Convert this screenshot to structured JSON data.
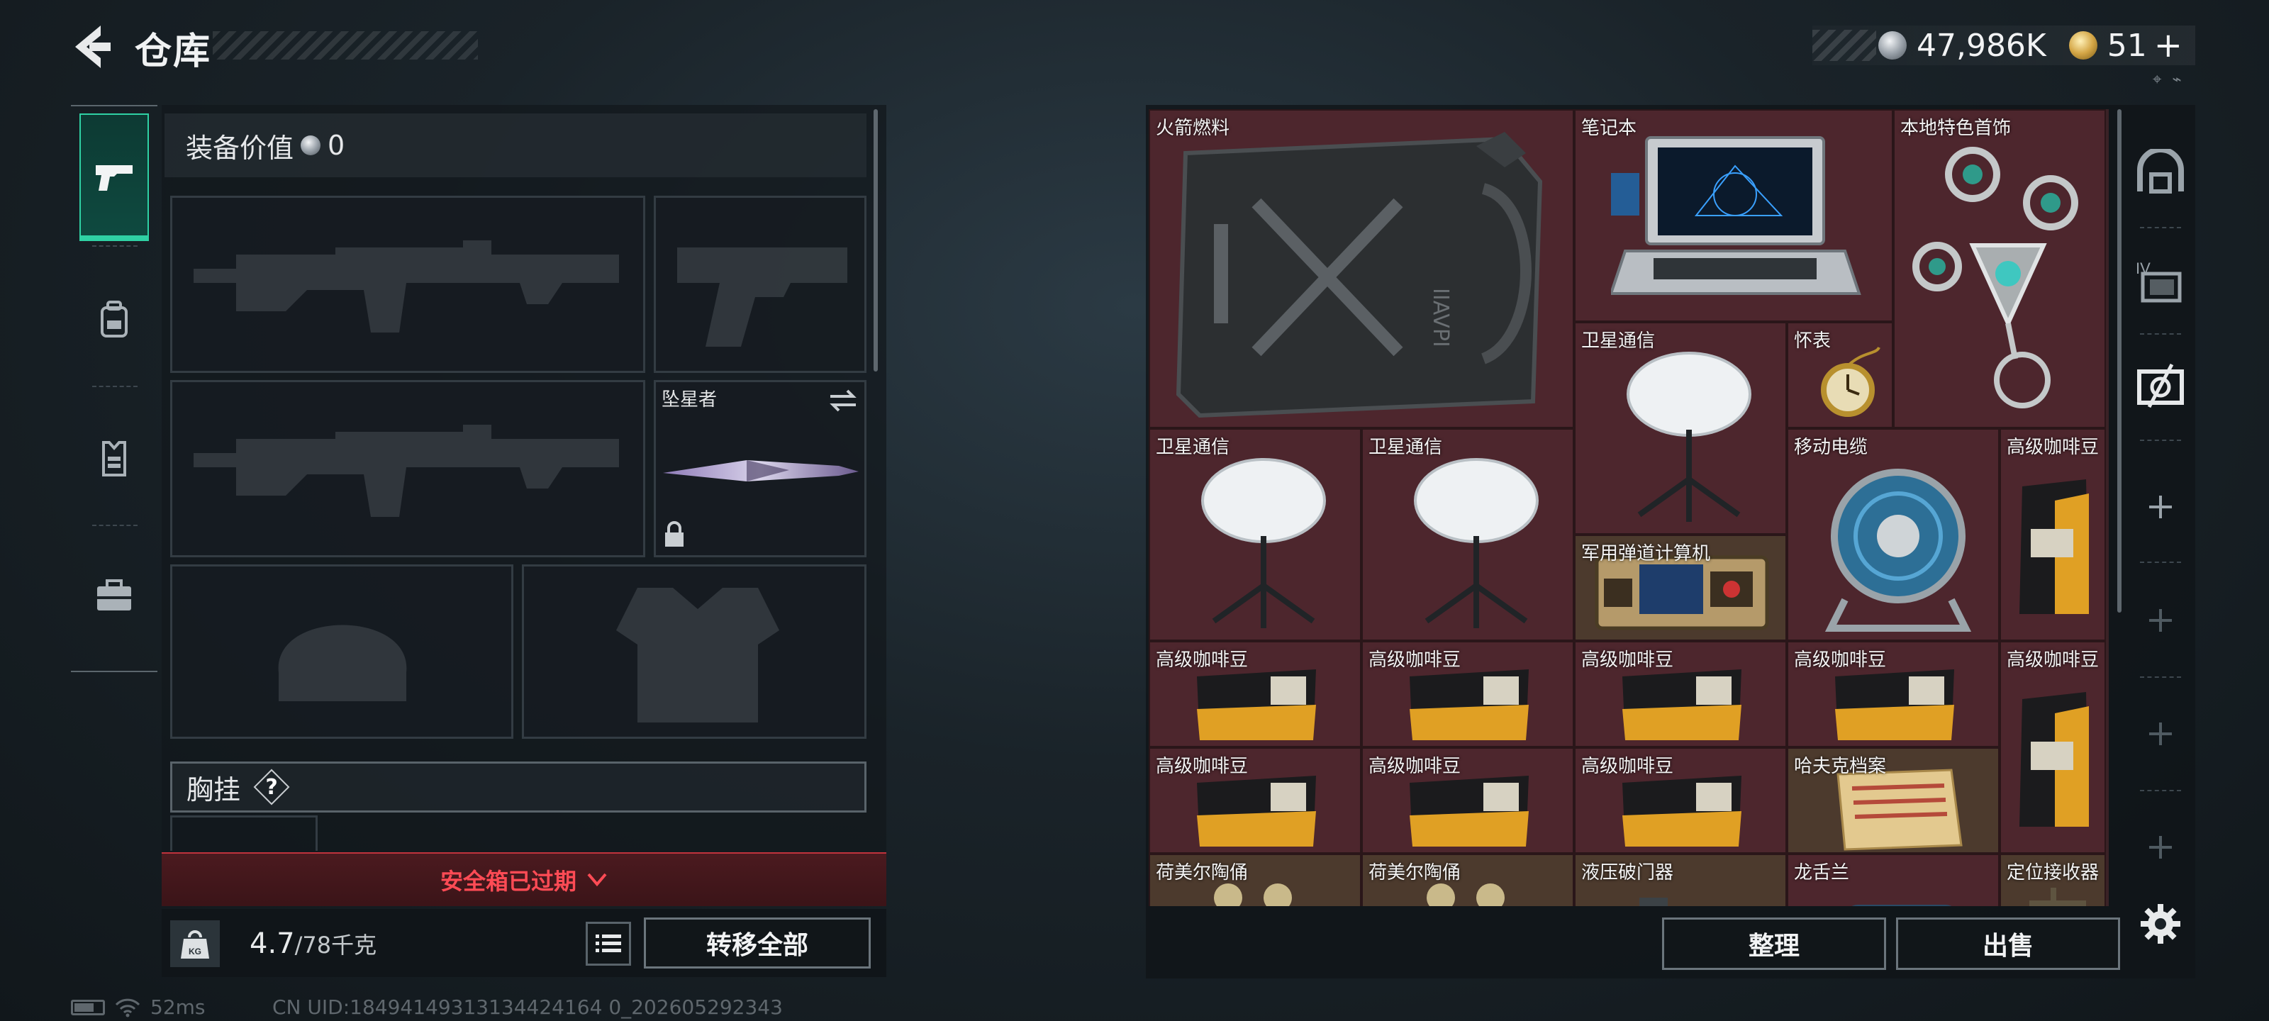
{
  "header": {
    "title": "仓库",
    "currency": [
      {
        "type": "silver",
        "value": "47,986K"
      },
      {
        "type": "gold",
        "value": "51",
        "suffix": "+"
      }
    ],
    "mini_icons": "⌖ ⌁"
  },
  "left_nav": {
    "tabs": [
      {
        "icon": "pistol-icon",
        "active": true
      },
      {
        "icon": "backpack-icon",
        "active": false
      },
      {
        "icon": "vest-icon",
        "active": false
      },
      {
        "icon": "briefcase-icon",
        "active": false
      }
    ]
  },
  "loadout": {
    "equip_value_label": "装备价值",
    "equip_value": "0",
    "melee_name": "坠星者",
    "chest_rig_label": "胸挂",
    "help_symbol": "?"
  },
  "safebox": {
    "label": "安全箱已过期"
  },
  "weight": {
    "current": "4.7",
    "max": "/78千克",
    "icon_label": "KG"
  },
  "buttons": {
    "transfer_all": "转移全部",
    "sort": "整理",
    "sell": "出售"
  },
  "status": {
    "ping": "52ms",
    "uid": "CN UID:18494149313134424164 0_202605292343"
  },
  "stash": {
    "items": [
      {
        "id": "rocket-fuel",
        "name": "火箭燃料"
      },
      {
        "id": "laptop",
        "name": "笔记本"
      },
      {
        "id": "local-jewelry",
        "name": "本地特色首饰"
      },
      {
        "id": "satcom-1",
        "name": "卫星通信"
      },
      {
        "id": "pocket-watch",
        "name": "怀表"
      },
      {
        "id": "satcom-2",
        "name": "卫星通信"
      },
      {
        "id": "satcom-3",
        "name": "卫星通信"
      },
      {
        "id": "cable-reel",
        "name": "移动电缆"
      },
      {
        "id": "coffee-tall-1",
        "name": "高级咖啡豆"
      },
      {
        "id": "ballistic-calc",
        "name": "军用弹道计算机"
      },
      {
        "id": "coffee-1",
        "name": "高级咖啡豆"
      },
      {
        "id": "coffee-2",
        "name": "高级咖啡豆"
      },
      {
        "id": "coffee-3",
        "name": "高级咖啡豆"
      },
      {
        "id": "coffee-4",
        "name": "高级咖啡豆"
      },
      {
        "id": "coffee-tall-2",
        "name": "高级咖啡豆"
      },
      {
        "id": "coffee-5",
        "name": "高级咖啡豆"
      },
      {
        "id": "coffee-6",
        "name": "高级咖啡豆"
      },
      {
        "id": "coffee-7",
        "name": "高级咖啡豆"
      },
      {
        "id": "hafk-file",
        "name": "哈夫克档案"
      },
      {
        "id": "dutch-figurine-1",
        "name": "荷美尔陶俑"
      },
      {
        "id": "dutch-figurine-2",
        "name": "荷美尔陶俑"
      },
      {
        "id": "hydraulic-breacher",
        "name": "液压破门器"
      },
      {
        "id": "dragon-tongue",
        "name": "龙舌兰"
      },
      {
        "id": "gps-receiver",
        "name": "定位接收器"
      }
    ]
  }
}
